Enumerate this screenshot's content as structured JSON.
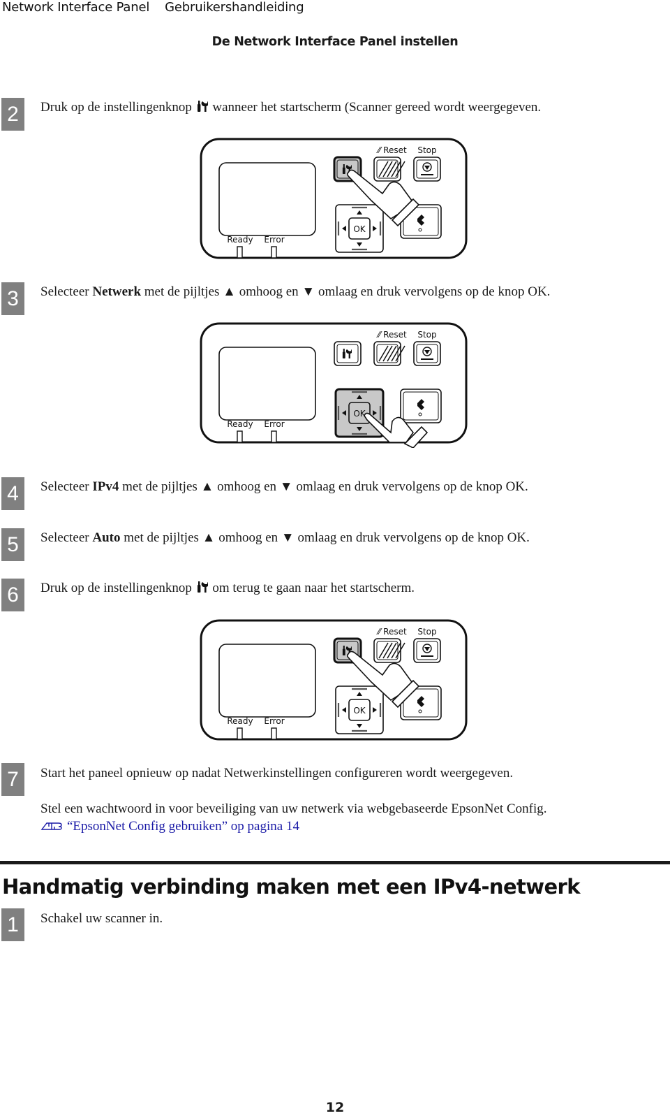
{
  "header": {
    "product": "Network Interface Panel",
    "doc_type": "Gebruikershandleiding",
    "section_title": "De Network Interface Panel instellen"
  },
  "steps": [
    {
      "number": "2",
      "pre": "Druk op de instellingenknop",
      "bold": "",
      "post": "wanneer het startscherm (Scanner gereed wordt weergegeven.",
      "has_tool_icon": true
    },
    {
      "number": "3",
      "pre": "Selecteer ",
      "bold": "Netwerk",
      "post": " met de pijltjes ▲ omhoog en ▼ omlaag en druk vervolgens op de knop OK."
    },
    {
      "number": "4",
      "pre": "Selecteer ",
      "bold": "IPv4",
      "post": " met de pijltjes ▲ omhoog en ▼ omlaag en druk vervolgens op de knop OK."
    },
    {
      "number": "5",
      "pre": "Selecteer ",
      "bold": "Auto",
      "post": " met de pijltjes ▲ omhoog en ▼ omlaag en druk vervolgens op de knop OK."
    },
    {
      "number": "6",
      "pre": "Druk op de instellingenknop",
      "bold": "",
      "post": "om terug te gaan naar het startscherm.",
      "has_tool_icon": true
    },
    {
      "number": "7",
      "pre": "Start het paneel opnieuw op nadat Netwerkinstellingen configureren wordt weergegeven.",
      "bold": "",
      "post": ""
    }
  ],
  "step7_note": "Stel een wachtwoord in voor beveiliging van uw netwerk via webgebaseerde EpsonNet Config.",
  "step7_link": "“EpsonNet Config gebruiken” op pagina 14",
  "panel": {
    "reset_label": "Reset",
    "stop_label": "Stop",
    "ok_label": "OK",
    "ready_label": "Ready",
    "error_label": "Error"
  },
  "diagrams": [
    {
      "pressed": "settings"
    },
    {
      "pressed": "ok"
    },
    {
      "pressed": "settings"
    }
  ],
  "section2": {
    "heading": "Handmatig verbinding maken met een IPv4-netwerk",
    "steps": [
      {
        "number": "1",
        "text": "Schakel uw scanner in."
      }
    ]
  },
  "page_number": "12",
  "colors": {
    "badge": "#808080",
    "link": "#1a1aa6",
    "pressed_button": "#c8c8c8"
  }
}
